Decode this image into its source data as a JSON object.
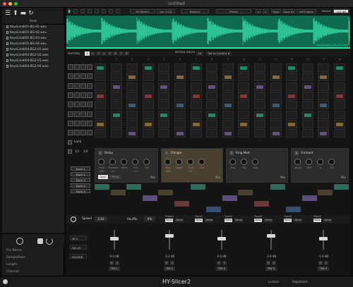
{
  "window": {
    "title": "Untitled"
  },
  "sidebar": {
    "root_label": "Root",
    "files": [
      "KeysLinaK01-BG-01.wav",
      "KeysLinaK01-BG-02.wav",
      "KeysLinaK01-BG-03.wav",
      "KeysLinaK01-BG-04.wav",
      "KeysLinaK04-BG2-01.wav",
      "KeysLinaK04-BG2-02.wav",
      "KeysLinaK04-BG2-03.wav",
      "KeysLinaK04-BG2-04.wav"
    ],
    "meta": [
      "File Name:",
      "SampleRate:",
      "Length:",
      "Channel:"
    ]
  },
  "toolbar": {
    "sample": "HY-Slicer2",
    "version": "ver 1.0.4",
    "mode": "Regular",
    "preset": "Preset",
    "save": "Save",
    "save_as": "Save As",
    "author": "HY-Plugins",
    "master": "Master",
    "master_db": "-0.0 dB"
  },
  "waveform": {
    "file": "KeysLinaK02-BG-02.wav"
  },
  "pattern": {
    "label": "PATTERN",
    "numbers": [
      "1",
      "2",
      "3",
      "4",
      "5",
      "6",
      "7",
      "8"
    ],
    "pattern_length_label": "PATTERN LENGTH",
    "length": "16",
    "source": "Set to Current #"
  },
  "steps": [
    "1",
    "2",
    "3",
    "4",
    "5",
    "6",
    "7",
    "8",
    "9",
    "10",
    "11",
    "12",
    "13",
    "14",
    "15",
    "16"
  ],
  "lock_label": "Lock",
  "fx": [
    {
      "num": "1",
      "name": "Delay",
      "knobs": [
        "Time",
        "Feedback",
        "Send",
        "Pan",
        "Mix"
      ],
      "values": [
        "1/8D",
        "0.5",
        "-",
        "0.5",
        ""
      ],
      "btn1": "Sync",
      "btn2": "PPong"
    },
    {
      "num": "2",
      "name": "Flanger",
      "knobs": [
        "Freq",
        "Depth",
        "Fdbk",
        "Mix"
      ],
      "values": [
        "1/8D",
        "",
        "0.5",
        ""
      ]
    },
    {
      "num": "3",
      "name": "Ring Mod",
      "knobs": [
        "Freq",
        "Mix",
        "Amt"
      ],
      "values": [
        "",
        "",
        ""
      ]
    },
    {
      "num": "4",
      "name": "Formant",
      "knobs": [
        "Vowel",
        "Shift",
        "Q",
        "Mix"
      ],
      "values": [
        "",
        "",
        "",
        ""
      ]
    }
  ],
  "mix_label": "Mix",
  "tracks": [
    "Track 1",
    "Track 2",
    "Track 3",
    "Track 4",
    "Track 5"
  ],
  "track_toolbar": [
    "1/1",
    "1/4"
  ],
  "speed": {
    "label": "Speed",
    "value": "1/16",
    "shuffle": "Shuffle",
    "shuffle_value": "0%"
  },
  "output_labels": [
    "Output",
    "Track1",
    "Track2",
    "Track3",
    "Track4",
    "Track5"
  ],
  "output_sub": [
    "Mono",
    "Stereo"
  ],
  "sends": [
    {
      "label": "MFX"
    },
    {
      "label": "DELAY"
    },
    {
      "label": "REVERB"
    }
  ],
  "channels": [
    {
      "db": "0.0 dB",
      "trk": "TRK 1"
    },
    {
      "db": "-3.2 dB",
      "trk": "TRK 2"
    },
    {
      "db": "0.0 dB",
      "trk": "TRK 3"
    },
    {
      "db": "-3.9 dB",
      "trk": "TRK 4"
    },
    {
      "db": "-1.6 dB",
      "trk": "TRK 5"
    }
  ],
  "ms": [
    "M",
    "S"
  ],
  "footer": {
    "product": "HY-Slicer2",
    "license": "License",
    "registered": "Registered"
  },
  "colors": {
    "accent": "#1fe3a3",
    "wave_bg": "#0d6a4e",
    "flanger": "#e0b347",
    "violet": "#9a7bd8",
    "red": "#d84a4a",
    "blue": "#4a8fd8"
  }
}
